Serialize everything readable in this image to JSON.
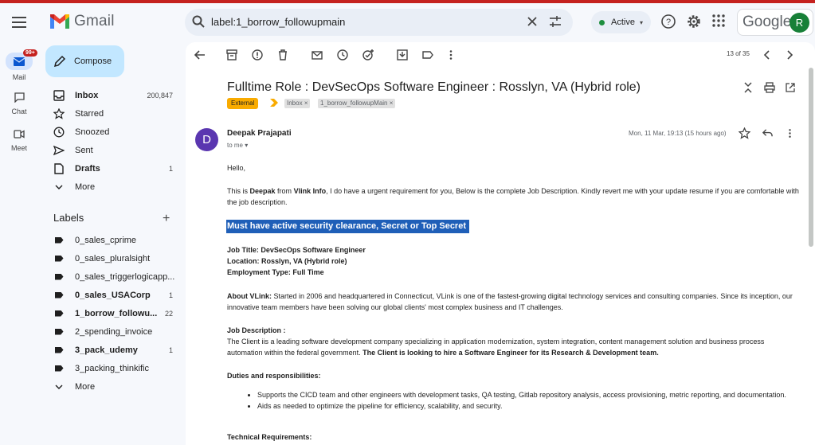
{
  "header": {
    "app_name": "Gmail",
    "search_query": "label:1_borrow_followupmain",
    "status": "Active",
    "google_label": "Google",
    "avatar_letter": "R"
  },
  "rail": {
    "mail_badge": "99+",
    "items": [
      "Mail",
      "Chat",
      "Meet"
    ]
  },
  "sidebar": {
    "compose_label": "Compose",
    "nav": [
      {
        "label": "Inbox",
        "count": "200,847"
      },
      {
        "label": "Starred",
        "count": ""
      },
      {
        "label": "Snoozed",
        "count": ""
      },
      {
        "label": "Sent",
        "count": ""
      },
      {
        "label": "Drafts",
        "count": "1"
      },
      {
        "label": "More",
        "count": ""
      }
    ],
    "labels_title": "Labels",
    "labels": [
      {
        "label": "0_sales_cprime",
        "count": ""
      },
      {
        "label": "0_sales_pluralsight",
        "count": ""
      },
      {
        "label": "0_sales_triggerlogicapp...",
        "count": ""
      },
      {
        "label": "0_sales_USACorp",
        "count": "1"
      },
      {
        "label": "1_borrow_followu...",
        "count": "22"
      },
      {
        "label": "2_spending_invoice",
        "count": ""
      },
      {
        "label": "3_pack_udemy",
        "count": "1"
      },
      {
        "label": "3_packing_thinkific",
        "count": ""
      },
      {
        "label": "More",
        "count": ""
      }
    ]
  },
  "toolbar": {
    "page_count": "13 of 35"
  },
  "email": {
    "subject": "Fulltime Role : DevSecOps Software Engineer : Rosslyn, VA (Hybrid role)",
    "external_label": "External",
    "chips": [
      "Inbox",
      "1_borrow_followupMain"
    ],
    "chip_close": "×",
    "sender_initial": "D",
    "sender": "Deepak Prajapati",
    "to": "to me",
    "date": "Mon, 11 Mar, 19:13 (15 hours ago)",
    "greeting": "Hello,",
    "intro": {
      "p1": "This is ",
      "name": "Deepak",
      "p2": " from ",
      "company": "Vlink Info",
      "p3": ", I do have a urgent requirement for you, Below is the complete Job Description. Kindly revert me with your update resume if you are comfortable with the job description."
    },
    "highlight": "Must have active security clearance, Secret or Top Secret",
    "job_title": "Job Title: DevSecOps Software Engineer",
    "location": "Location: Rosslyn, VA (Hybrid role)",
    "employment": "Employment Type: Full Time",
    "about_label": "About VLink:",
    "about_text": " Started in 2006 and headquartered in Connecticut, VLink is one of the fastest-growing digital technology services and consulting companies. Since its inception, our innovative team members have been solving our global clients' most complex business and IT challenges.",
    "jd_label": "Job Description :",
    "jd_text": "The Client iis a leading software development company specializing in application modernization, system integration, content management solution and business process automation within the federal government. ",
    "jd_bold": "The Client is looking to hire a Software Engineer for its Research & Development team.",
    "duties_label": "Duties and responsibilities:",
    "duties": [
      "Supports the CICD team and other engineers with development tasks, QA testing, Gitlab repository analysis, access provisioning, metric reporting, and documentation.",
      "Aids as needed to optimize the pipeline for efficiency, scalability, and security."
    ],
    "tech_label": "Technical Requirements:"
  }
}
